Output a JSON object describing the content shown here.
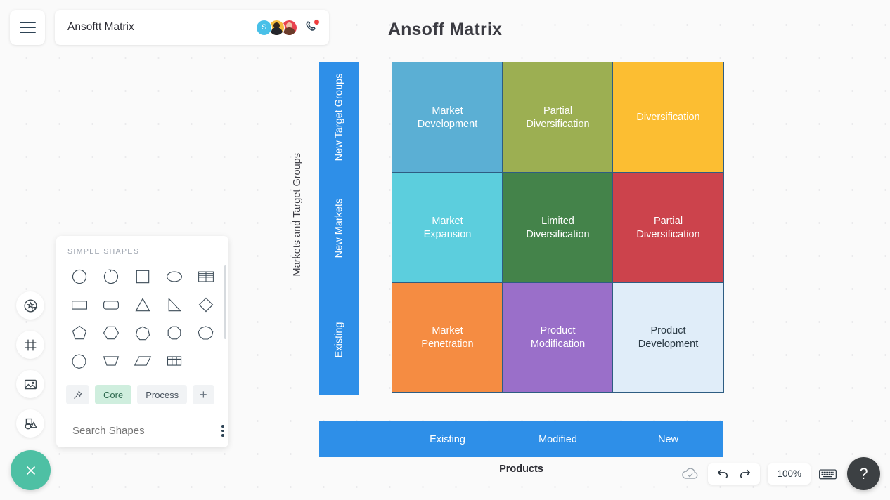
{
  "topbar": {
    "menu_icon": "hamburger-icon",
    "doc_title": "Ansoftt Matrix",
    "avatars": [
      {
        "name": "avatar-s",
        "initial": "S",
        "color": "#49c0e8"
      },
      {
        "name": "avatar-2",
        "initial": "",
        "color": "#f5bb3d"
      },
      {
        "name": "avatar-3",
        "initial": "",
        "color": "#e8434f"
      }
    ],
    "call_icon": "phone-icon",
    "call_badge": "notification-dot"
  },
  "canvas": {
    "title": "Ansoff Matrix"
  },
  "chart_data": {
    "type": "matrix",
    "title": "Ansoff Matrix",
    "xlabel": "Products",
    "ylabel": "Markets and Target Groups",
    "x_categories": [
      "Existing",
      "Modified",
      "New"
    ],
    "y_categories": [
      "New Target Groups",
      "New Markets",
      "Existing"
    ],
    "axis_band_color": "#2e8fe8",
    "cell_border_color": "#2e5d82",
    "cells": [
      {
        "row": 0,
        "col": 0,
        "label": "Market\nDevelopment",
        "label_line1": "Market",
        "label_line2": "Development",
        "color": "#5bafd4",
        "text_color": "#ffffff"
      },
      {
        "row": 0,
        "col": 1,
        "label": "Partial\nDiversification",
        "label_line1": "Partial",
        "label_line2": "Diversification",
        "color": "#9caf52",
        "text_color": "#ffffff"
      },
      {
        "row": 0,
        "col": 2,
        "label": "Diversification",
        "label_line1": "Diversification",
        "label_line2": "",
        "color": "#fcbe32",
        "text_color": "#ffffff"
      },
      {
        "row": 1,
        "col": 0,
        "label": "Market\nExpansion",
        "label_line1": "Market",
        "label_line2": "Expansion",
        "color": "#5ccedd",
        "text_color": "#ffffff"
      },
      {
        "row": 1,
        "col": 1,
        "label": "Limited\nDiversification",
        "label_line1": "Limited",
        "label_line2": "Diversification",
        "color": "#44834a",
        "text_color": "#ffffff"
      },
      {
        "row": 1,
        "col": 2,
        "label": "Partial\nDiversification",
        "label_line1": "Partial",
        "label_line2": "Diversification",
        "color": "#cc434c",
        "text_color": "#ffffff"
      },
      {
        "row": 2,
        "col": 0,
        "label": "Market\nPenetration",
        "label_line1": "Market",
        "label_line2": "Penetration",
        "color": "#f58c42",
        "text_color": "#ffffff"
      },
      {
        "row": 2,
        "col": 1,
        "label": "Product\nModification",
        "label_line1": "Product",
        "label_line2": "Modification",
        "color": "#9a6fc9",
        "text_color": "#ffffff"
      },
      {
        "row": 2,
        "col": 2,
        "label": "Product\nDevelopment",
        "label_line1": "Product",
        "label_line2": "Development",
        "color": "#e0edf9",
        "text_color": "#2b3a45"
      }
    ]
  },
  "rail": {
    "items": [
      {
        "name": "stickers-icon",
        "label": "Stickers"
      },
      {
        "name": "frame-icon",
        "label": "Frame"
      },
      {
        "name": "image-icon",
        "label": "Image"
      },
      {
        "name": "shapes-icon",
        "label": "Shapes"
      }
    ]
  },
  "shapes_panel": {
    "heading": "SIMPLE SHAPES",
    "shapes": [
      "circle-shape",
      "arc-shape",
      "square-shape",
      "ellipse-shape",
      "table-rows-shape",
      "rectangle-shape",
      "rounded-rectangle-shape",
      "triangle-shape",
      "right-triangle-shape",
      "diamond-shape",
      "pentagon-shape",
      "hexagon-shape",
      "heptagon-shape",
      "octagon-shape",
      "nonagon-shape",
      "decagon-shape",
      "trapezoid-shape",
      "parallelogram-shape",
      "grid-table-shape"
    ],
    "tags": [
      {
        "name": "pin-tag",
        "label": "",
        "icon": "pin-icon",
        "active": false
      },
      {
        "name": "core-tag",
        "label": "Core",
        "icon": "",
        "active": true
      },
      {
        "name": "process-tag",
        "label": "Process",
        "icon": "",
        "active": false
      },
      {
        "name": "add-tag",
        "label": "+",
        "icon": "plus-icon",
        "active": false
      }
    ],
    "search_placeholder": "Search Shapes",
    "search_value": "",
    "more_icon": "kebab-menu-icon"
  },
  "fab": {
    "close_icon": "close-icon",
    "close_color": "#4ec0a4"
  },
  "bottom_toolbar": {
    "cloud_icon": "cloud-saved-icon",
    "undo_icon": "undo-icon",
    "redo_icon": "redo-icon",
    "zoom_level": "100%",
    "keyboard_icon": "keyboard-icon",
    "help_label": "?"
  }
}
